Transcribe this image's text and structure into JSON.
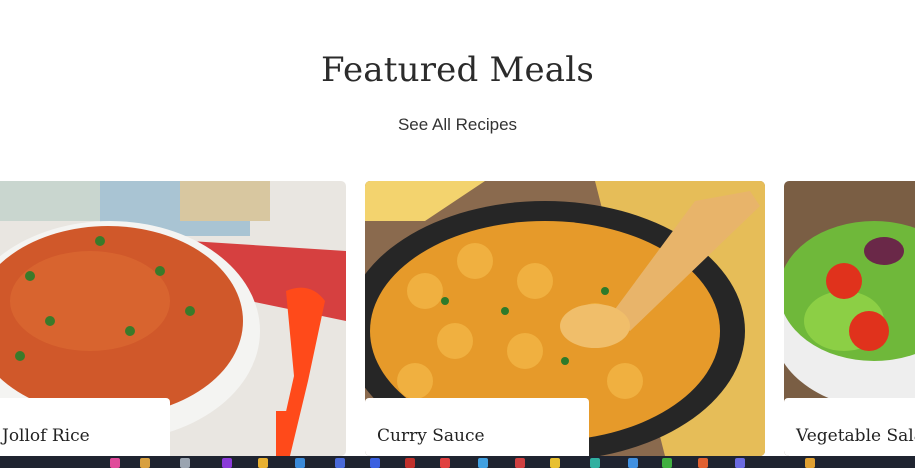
{
  "section": {
    "title": "Featured Meals",
    "see_all_label": "See All Recipes"
  },
  "cards": [
    {
      "label": "Jollof Rice"
    },
    {
      "label": "Curry Sauce"
    },
    {
      "label": "Vegetable Salad"
    }
  ],
  "colors": {
    "rice": "#d0582a",
    "curry": "#e69a2a",
    "pan": "#2a2a2a",
    "salad": "#6fb83a",
    "tomato": "#e0321c",
    "taskbar": "#1f2430"
  }
}
